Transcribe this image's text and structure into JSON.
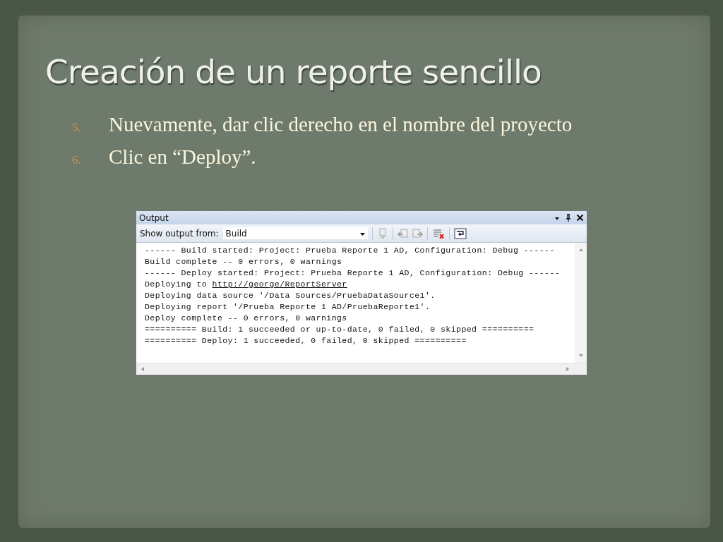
{
  "slide": {
    "title": "Creación de un reporte sencillo",
    "steps": [
      {
        "number": "5.",
        "text": "Nuevamente, dar clic derecho en el nombre del proyecto"
      },
      {
        "number": "6.",
        "text": "Clic en “Deploy”."
      }
    ]
  },
  "output_window": {
    "title": "Output",
    "show_output_label": "Show output from:",
    "source": "Build",
    "lines": [
      {
        "text": "------ Build started: Project: Prueba Reporte 1 AD, Configuration: Debug ------"
      },
      {
        "text": "Build complete -- 0 errors, 0 warnings"
      },
      {
        "text": "------ Deploy started: Project: Prueba Reporte 1 AD, Configuration: Debug ------"
      },
      {
        "text": "Deploying to ",
        "link": "http://george/ReportServer"
      },
      {
        "text": "Deploying data source '/Data Sources/PruebaDataSource1'."
      },
      {
        "text": "Deploying report '/Prueba Reporte 1 AD/PruebaReporte1'."
      },
      {
        "text": "Deploy complete -- 0 errors, 0 warnings"
      },
      {
        "text": "========== Build: 1 succeeded or up-to-date, 0 failed, 0 skipped =========="
      },
      {
        "text": "========== Deploy: 1 succeeded, 0 failed, 0 skipped =========="
      }
    ]
  }
}
